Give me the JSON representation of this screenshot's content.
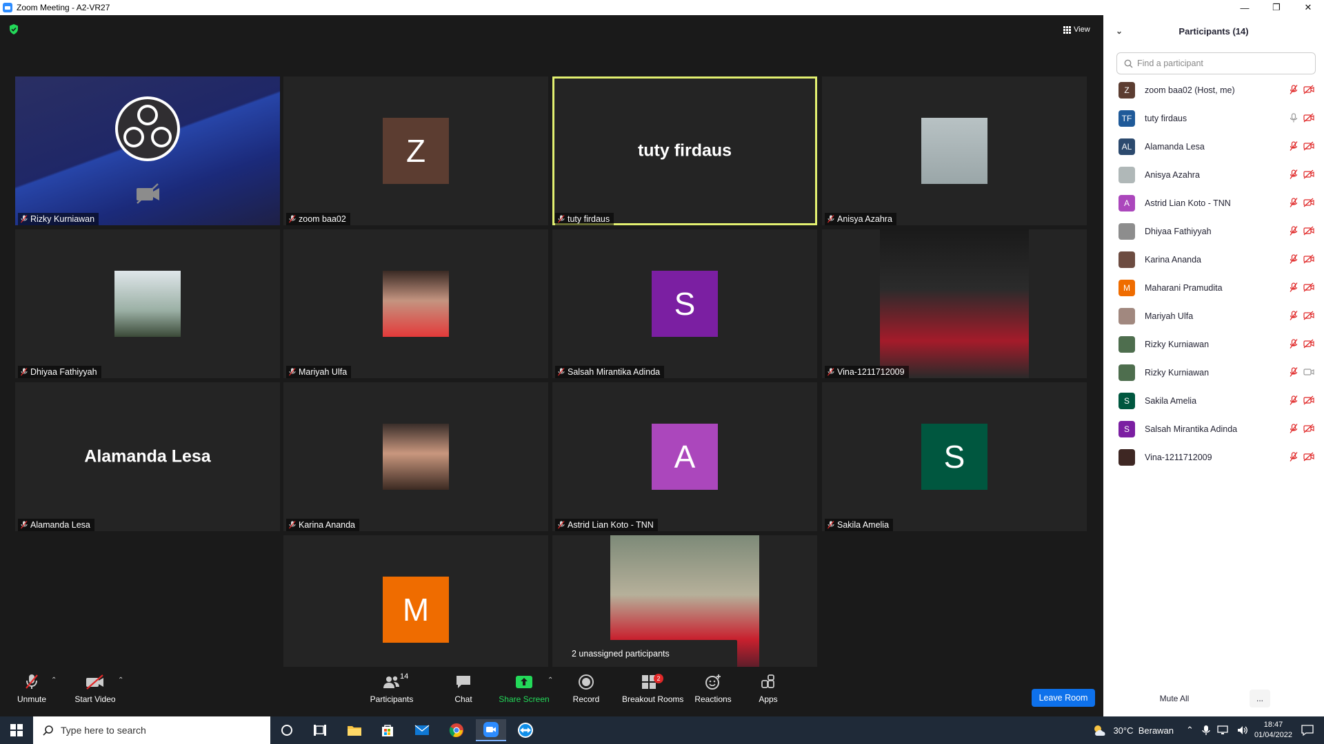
{
  "window": {
    "title": "Zoom Meeting - A2-VR27"
  },
  "view_label": "View",
  "tiles": [
    {
      "name": "Rizky Kurniawan",
      "kind": "obs"
    },
    {
      "name": "zoom baa02",
      "kind": "letter",
      "letter": "Z",
      "color": "#5c3d31"
    },
    {
      "name": "tuty firdaus",
      "kind": "bigname",
      "big": "tuty firdaus",
      "active": true
    },
    {
      "name": "Anisya Azahra",
      "kind": "photo"
    },
    {
      "name": "Dhiyaa Fathiyyah",
      "kind": "photo"
    },
    {
      "name": "Mariyah Ulfa",
      "kind": "photo"
    },
    {
      "name": "Salsah Mirantika Adinda",
      "kind": "letter",
      "letter": "S",
      "color": "#7b1fa2"
    },
    {
      "name": "Vina-1211712009",
      "kind": "photo"
    },
    {
      "name": "Alamanda Lesa",
      "kind": "bigname",
      "big": "Alamanda Lesa"
    },
    {
      "name": "Karina Ananda",
      "kind": "photo"
    },
    {
      "name": "Astrid Lian Koto - TNN",
      "kind": "letter",
      "letter": "A",
      "color": "#ab47bc"
    },
    {
      "name": "Sakila Amelia",
      "kind": "letter",
      "letter": "S",
      "color": "#00573f"
    },
    {
      "name": "Maharani Pramudita",
      "kind": "letter",
      "letter": "M",
      "color": "#ef6c00"
    },
    {
      "name": "",
      "kind": "photo"
    }
  ],
  "toast": "2 unassigned participants",
  "toolbar": {
    "unmute": "Unmute",
    "start_video": "Start Video",
    "participants": "Participants",
    "participants_count": "14",
    "chat": "Chat",
    "share_screen": "Share Screen",
    "record": "Record",
    "breakout_rooms": "Breakout Rooms",
    "breakout_badge": "2",
    "reactions": "Reactions",
    "apps": "Apps",
    "leave_room": "Leave Room"
  },
  "panel": {
    "title": "Participants (14)",
    "search_placeholder": "Find a participant",
    "mute_all": "Mute All",
    "more": "...",
    "participants": [
      {
        "name": "zoom baa02 (Host, me)",
        "initials": "Z",
        "color": "#5c3d31",
        "mic": "muted",
        "video": "off"
      },
      {
        "name": "tuty firdaus",
        "initials": "TF",
        "color": "#1f5a99",
        "mic": "on",
        "video": "off"
      },
      {
        "name": "Alamanda Lesa",
        "initials": "AL",
        "color": "#2c4a6e",
        "mic": "muted",
        "video": "off"
      },
      {
        "name": "Anisya Azahra",
        "initials": "",
        "color": "#b0b8b8",
        "mic": "muted",
        "video": "off"
      },
      {
        "name": "Astrid Lian Koto - TNN",
        "initials": "A",
        "color": "#ab47bc",
        "mic": "muted",
        "video": "off"
      },
      {
        "name": "Dhiyaa Fathiyyah",
        "initials": "",
        "color": "#8d8d8d",
        "mic": "muted",
        "video": "off"
      },
      {
        "name": "Karina Ananda",
        "initials": "",
        "color": "#6d4c41",
        "mic": "muted",
        "video": "off"
      },
      {
        "name": "Maharani Pramudita",
        "initials": "M",
        "color": "#ef6c00",
        "mic": "muted",
        "video": "off"
      },
      {
        "name": "Mariyah Ulfa",
        "initials": "",
        "color": "#a1887f",
        "mic": "muted",
        "video": "off"
      },
      {
        "name": "Rizky Kurniawan",
        "initials": "",
        "color": "#4e6e4e",
        "mic": "muted",
        "video": "off"
      },
      {
        "name": "Rizky Kurniawan",
        "initials": "",
        "color": "#4e6e4e",
        "mic": "muted",
        "video": "on"
      },
      {
        "name": "Sakila Amelia",
        "initials": "S",
        "color": "#00573f",
        "mic": "muted",
        "video": "off"
      },
      {
        "name": "Salsah Mirantika Adinda",
        "initials": "S",
        "color": "#7b1fa2",
        "mic": "muted",
        "video": "off"
      },
      {
        "name": "Vina-1211712009",
        "initials": "",
        "color": "#3e2723",
        "mic": "muted",
        "video": "off"
      }
    ]
  },
  "taskbar": {
    "search_placeholder": "Type here to search",
    "weather": "30°C  Berawan",
    "time": "18:47",
    "date": "01/04/2022"
  }
}
